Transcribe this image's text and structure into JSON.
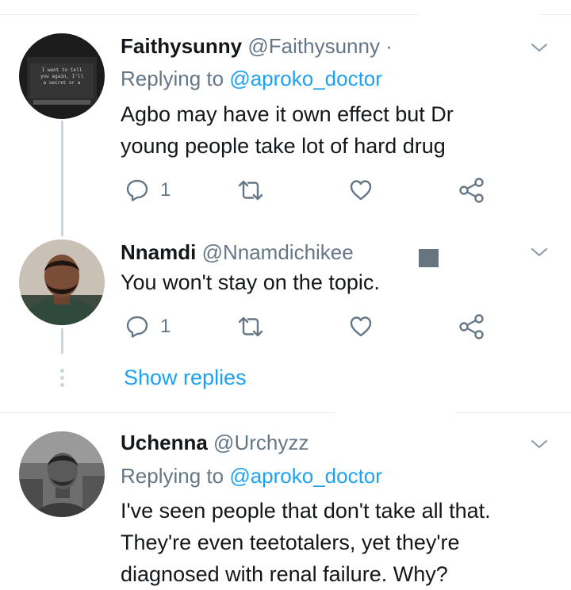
{
  "replying_prefix": "Replying to",
  "tweets": [
    {
      "name": "Faithysunny",
      "handle": "@Faithysunny",
      "separator": "·",
      "replying_to": "@aproko_doctor",
      "text_lines": [
        "Agbo may have it own effect but Dr",
        "young people take lot of hard drug"
      ],
      "reply_count": "1",
      "avatar_text": [
        "I want to tell",
        "you again, I'll",
        "a secret or a"
      ]
    },
    {
      "name": "Nnamdi",
      "handle": "@Nnamdichikee",
      "text_lines": [
        "You won't stay on the topic."
      ],
      "reply_count": "1"
    },
    {
      "name": "Uchenna",
      "handle": "@Urchyzz",
      "replying_to": "@aproko_doctor",
      "text_lines": [
        "I've seen people that don't take all that.",
        "They're even teetotalers, yet they're",
        "diagnosed with renal failure. Why?"
      ]
    }
  ],
  "show_replies_label": "Show replies",
  "colors": {
    "accent": "#1da1f2",
    "secondary_text": "#657786",
    "icon": "#657786",
    "divider": "#e6ecf0",
    "thread_line": "#ccd6dd"
  },
  "icons": [
    "reply-icon",
    "retweet-icon",
    "like-icon",
    "share-icon",
    "chevron-down-icon"
  ]
}
